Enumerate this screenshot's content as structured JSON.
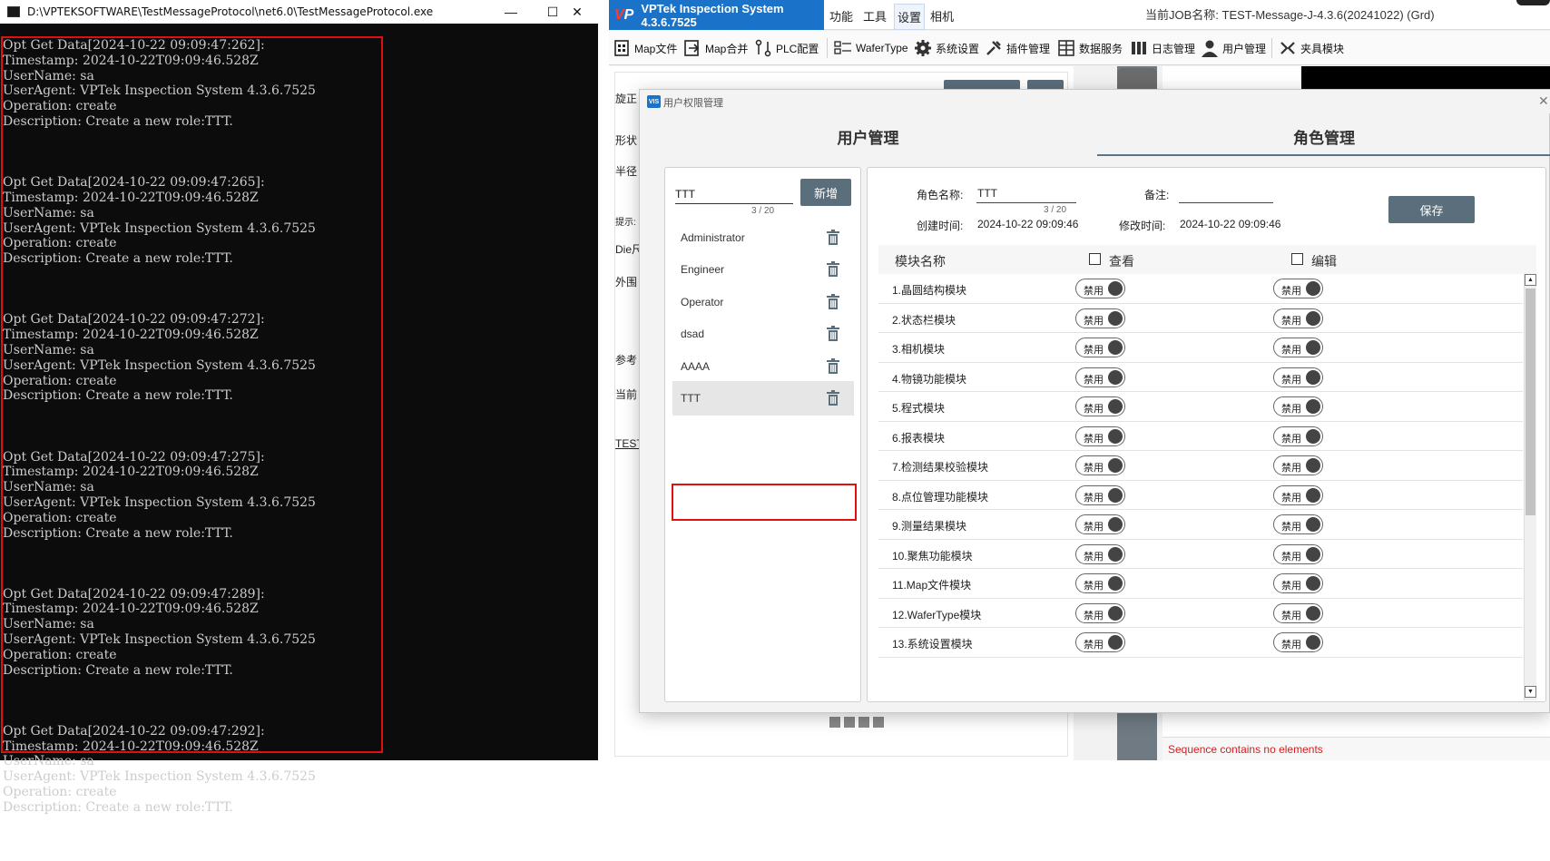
{
  "console": {
    "title": "D:\\VPTEKSOFTWARE\\TestMessageProtocol\\net6.0\\TestMessageProtocol.exe",
    "minimize_glyph": "—",
    "maximize_glyph": "☐",
    "close_glyph": "✕",
    "logs": [
      {
        "header": "Opt Get Data[2024-10-22 09:09:47:262]:",
        "timestamp": "Timestamp: 2024-10-22T09:09:46.528Z",
        "user": "UserName: sa",
        "agent": "UserAgent: VPTek Inspection System 4.3.6.7525",
        "operation": "Operation: create",
        "description": "Description: Create a new role:TTT."
      },
      {
        "header": "Opt Get Data[2024-10-22 09:09:47:265]:",
        "timestamp": "Timestamp: 2024-10-22T09:09:46.528Z",
        "user": "UserName: sa",
        "agent": "UserAgent: VPTek Inspection System 4.3.6.7525",
        "operation": "Operation: create",
        "description": "Description: Create a new role:TTT."
      },
      {
        "header": "Opt Get Data[2024-10-22 09:09:47:272]:",
        "timestamp": "Timestamp: 2024-10-22T09:09:46.528Z",
        "user": "UserName: sa",
        "agent": "UserAgent: VPTek Inspection System 4.3.6.7525",
        "operation": "Operation: create",
        "description": "Description: Create a new role:TTT."
      },
      {
        "header": "Opt Get Data[2024-10-22 09:09:47:275]:",
        "timestamp": "Timestamp: 2024-10-22T09:09:46.528Z",
        "user": "UserName: sa",
        "agent": "UserAgent: VPTek Inspection System 4.3.6.7525",
        "operation": "Operation: create",
        "description": "Description: Create a new role:TTT."
      },
      {
        "header": "Opt Get Data[2024-10-22 09:09:47:289]:",
        "timestamp": "Timestamp: 2024-10-22T09:09:46.528Z",
        "user": "UserName: sa",
        "agent": "UserAgent: VPTek Inspection System 4.3.6.7525",
        "operation": "Operation: create",
        "description": "Description: Create a new role:TTT."
      },
      {
        "header": "Opt Get Data[2024-10-22 09:09:47:292]:",
        "timestamp": "Timestamp: 2024-10-22T09:09:46.528Z",
        "user": "UserName: sa",
        "agent": "UserAgent: VPTek Inspection System 4.3.6.7525",
        "operation": "Operation: create",
        "description": "Description: Create a new role:TTT."
      }
    ]
  },
  "app": {
    "brand_logo": "VP",
    "title": "VPTek Inspection System 4.3.6.7525",
    "menu": [
      "功能",
      "工具",
      "设置",
      "相机"
    ],
    "job_label": "当前JOB名称:  TEST-Message-J-4.3.6(20241022) (Grd)",
    "toolbar": [
      {
        "label": "Map文件",
        "icon": "map-file-icon"
      },
      {
        "label": "Map合并",
        "icon": "map-merge-icon"
      },
      {
        "label": "PLC配置",
        "icon": "plc-icon"
      },
      {
        "label": "WaferType",
        "icon": "wafer-type-icon"
      },
      {
        "label": "系统设置",
        "icon": "gear-icon"
      },
      {
        "label": "插件管理",
        "icon": "plugin-icon"
      },
      {
        "label": "数据服务",
        "icon": "data-service-icon"
      },
      {
        "label": "日志管理",
        "icon": "log-icon"
      },
      {
        "label": "用户管理",
        "icon": "user-icon"
      },
      {
        "label": "夹具模块",
        "icon": "fixture-icon"
      }
    ],
    "background_labels": [
      "旋正",
      "形状",
      "半径",
      "提示:",
      "Die尺",
      "外围",
      "参考",
      "当前",
      "TEST-"
    ],
    "error_text": "Sequence contains no elements"
  },
  "dialog": {
    "title": "用户权限管理",
    "close_glyph": "✕",
    "tabs": [
      "用户管理",
      "角色管理"
    ],
    "active_tab": "角色管理",
    "role_input": {
      "value": "TTT",
      "count": "3 / 20"
    },
    "add_label": "新增",
    "roles": [
      "Administrator",
      "Engineer",
      "Operator",
      "dsad",
      "AAAA",
      "TTT"
    ],
    "selected_role": "TTT",
    "detail": {
      "role_name_label": "角色名称:",
      "role_name_value": "TTT",
      "role_name_count": "3 / 20",
      "remark_label": "备注:",
      "remark_value": "",
      "created_label": "创建时间:",
      "created_value": "2024-10-22 09:09:46",
      "modified_label": "修改时间:",
      "modified_value": "2024-10-22 09:09:46",
      "save_label": "保存"
    },
    "permission_header": {
      "module": "模块名称",
      "view": "查看",
      "edit": "编辑"
    },
    "toggle_label": "禁用",
    "modules": [
      "1.晶圆结构模块",
      "2.状态栏模块",
      "3.相机模块",
      "4.物镜功能模块",
      "5.程式模块",
      "6.报表模块",
      "7.检测结果校验模块",
      "8.点位管理功能模块",
      "9.测量结果模块",
      "10.聚焦功能模块",
      "11.Map文件模块",
      "12.WaferType模块",
      "13.系统设置模块"
    ]
  }
}
